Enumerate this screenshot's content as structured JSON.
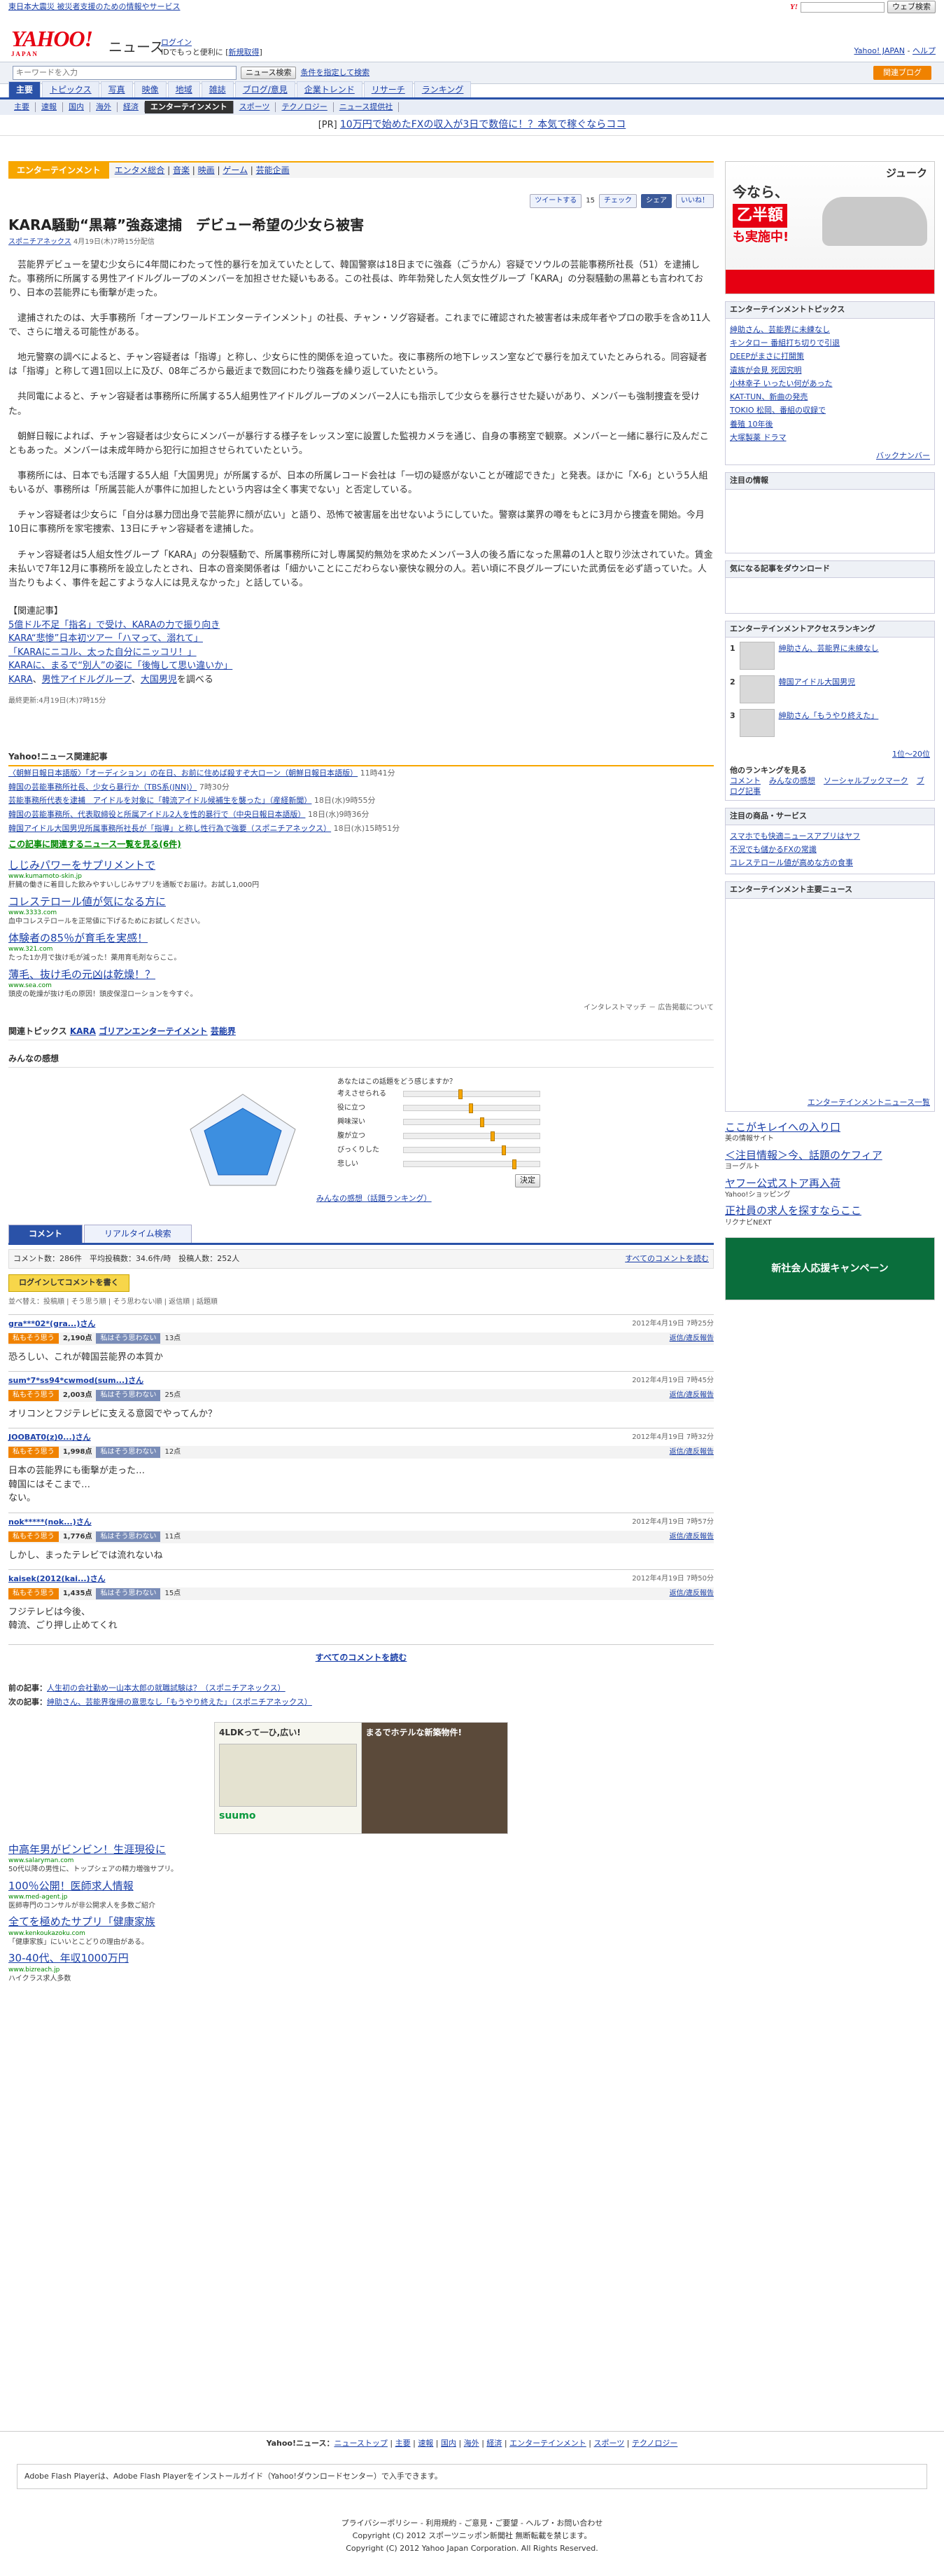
{
  "topbar": {
    "left_link": "東日本大震災 被災者支援のための情報やサービス",
    "search_btn": "ウェブ検索"
  },
  "header": {
    "logo": "YAHOO!",
    "logo_sub": "JAPAN",
    "section": "ニュース",
    "login": "ログイン",
    "login_note": "IDでもっと便利に",
    "signup": "新規取得",
    "right": "Yahoo! JAPAN",
    "help": "ヘルプ"
  },
  "search": {
    "placeholder": "キーワードを入力",
    "button": "ニュース検索",
    "advanced": "条件を指定して検索",
    "blog": "関連ブログ"
  },
  "nav": {
    "tabs": [
      "主要",
      "トピックス",
      "写真",
      "映像",
      "地域",
      "雑誌",
      "ブログ/意見",
      "企業トレンド",
      "リサーチ",
      "ランキング"
    ],
    "subs": [
      "主要",
      "速報",
      "国内",
      "海外",
      "経済",
      "エンターテインメント",
      "スポーツ",
      "テクノロジー",
      "ニュース提供社"
    ]
  },
  "pr": {
    "label": "[PR]",
    "text": "10万円で始めたFXの収入が3日で数倍に！？本気で稼ぐならココ"
  },
  "category": {
    "label": "エンターテインメント",
    "links": [
      "エンタメ総合",
      "音楽",
      "映画",
      "ゲーム",
      "芸能企画"
    ]
  },
  "share": {
    "tweet": "ツイートする",
    "count": "15",
    "check": "チェック",
    "share": "シェア",
    "like": "いいね！"
  },
  "article": {
    "title": "KARA騒動“黒幕”強姦逮捕　デビュー希望の少女ら被害",
    "source": "スポニチアネックス",
    "date": "4月19日(木)7時15分配信",
    "paragraphs": [
      "芸能界デビューを望む少女らに4年間にわたって性的暴行を加えていたとして、韓国警察は18日までに強姦（ごうかん）容疑でソウルの芸能事務所社長（51）を逮捕した。事務所に所属する男性アイドルグループのメンバーを加担させた疑いもある。この社長は、昨年勃発した人気女性グループ「KARA」の分裂騒動の黒幕とも言われており、日本の芸能界にも衝撃が走った。",
      "逮捕されたのは、大手事務所「オープンワールドエンターテインメント」の社長、チャン・ソグ容疑者。これまでに確認された被害者は未成年者やプロの歌手を含め11人で、さらに増える可能性がある。",
      "地元警察の調べによると、チャン容疑者は「指導」と称し、少女らに性的関係を迫っていた。夜に事務所の地下レッスン室などで暴行を加えていたとみられる。同容疑者は「指導」と称して週1回以上に及び、08年ごろから最近まで数回にわたり強姦を繰り返していたという。",
      "共同電によると、チャン容疑者は事務所に所属する5人組男性アイドルグループのメンバー2人にも指示して少女らを暴行させた疑いがあり、メンバーも強制捜査を受けた。",
      "朝鮮日報によれば、チャン容疑者は少女らにメンバーが暴行する様子をレッスン室に設置した監視カメラを通じ、自身の事務室で観察。メンバーと一緒に暴行に及んだこともあった。メンバーは未成年時から犯行に加担させられていたという。",
      "事務所には、日本でも活躍する5人組「大国男児」が所属するが、日本の所属レコード会社は「一切の疑惑がないことが確認できた」と発表。ほかに「X-6」という5人組もいるが、事務所は「所属芸能人が事件に加担したという内容は全く事実でない」と否定している。",
      "チャン容疑者は少女らに「自分は暴力団出身で芸能界に顔が広い」と語り、恐怖で被害届を出せないようにしていた。警察は業界の噂をもとに3月から捜査を開始。今月10日に事務所を家宅捜索、13日にチャン容疑者を逮捕した。",
      "チャン容疑者は5人組女性グループ「KARA」の分裂騒動で、所属事務所に対し専属契約無効を求めたメンバー3人の後ろ盾になった黒幕の1人と取り沙汰されていた。賃金未払いで7年12月に事務所を設立したとされ、日本の音楽関係者は「細かいことにこだわらない豪快な親分の人。若い頃に不良グループにいた武勇伝を必ず語っていた。人当たりもよく、事件を起こすような人には見えなかった」と話している。"
    ],
    "related_head": "【関連記事】",
    "related": [
      "5億ドル不足「指名」で受け、KARAの力で振り向き",
      "KARA“悲惨”日本初ツアー「ハマって、溺れて」",
      "「KARAにニコル、太った自分にニッコリ！」",
      "KARAに、まるで“別人”の姿に「後悔して思い違いか」"
    ],
    "related_tags": [
      "KARA",
      "男性アイドルグループ",
      "大国男児"
    ],
    "related_tail": "を調べる",
    "updated": "最終更新:4月19日(木)7時15分",
    "spon": "Sponichi Annex"
  },
  "yahoo_related": {
    "title": "Yahoo!ニュース関連記事",
    "items": [
      {
        "t": "〈朝鮮日報日本語版〉「オーディション」の在日、お前に住めば殺すぞ大ローン（朝鮮日報日本語版）",
        "d": "11時41分"
      },
      {
        "t": "韓国の芸能事務所社長、少女ら暴行か（TBS系(JNN)）",
        "d": "7時30分"
      },
      {
        "t": "芸能事務所代表を逮捕　アイドルを対象に「韓流アイドル候補生を襲った」（産経新聞）",
        "d": "18日(水)9時55分"
      },
      {
        "t": "韓国の芸能事務所、代表取締役と所属アイドル2人を性的暴行で（中央日報日本語版）",
        "d": "18日(水)9時36分"
      },
      {
        "t": "韓国アイドル大国男児所属事務所社長が「指導」と称し性行為で強要（スポニチアネックス）",
        "d": "18日(水)15時51分"
      }
    ],
    "more": "この記事に関連するニュース一覧を見る(6件)"
  },
  "ads": [
    {
      "t": "しじみパワーをサプリメントで",
      "u": "www.kumamoto-skin.jp",
      "d": "肝臓の働きに着目した飲みやすいしじみサプリを通販でお届け。お試し1,000円"
    },
    {
      "t": "コレステロール値が気になる方に",
      "u": "www.3333.com",
      "d": "血中コレステロールを正常値に下げるためにお試しください。"
    },
    {
      "t": "体験者の85％が育毛を実感！",
      "u": "www.321.com",
      "d": "たった1か月で抜け毛が減った！薬用育毛剤ならここ。"
    },
    {
      "t": "薄毛、抜け毛の元凶は乾燥！？",
      "u": "www.sea.com",
      "d": "頭皮の乾燥が抜け毛の原因！頭皮保湿ローションを今すぐ。"
    }
  ],
  "ads_note": "インタレストマッチ － 広告掲載について",
  "topics": {
    "label": "関連トピックス",
    "links": [
      "KARA",
      "ゴリアンエンターテイメント",
      "芸能界"
    ]
  },
  "feel": {
    "title": "みんなの感想",
    "q": "あなたはこの話題をどう感じますか？",
    "labels": [
      "考えさせられる",
      "役に立つ",
      "興味深い",
      "腹が立つ",
      "びっくりした",
      "悲しい"
    ],
    "submit": "決定",
    "rank_link": "みんなの感想（話題ランキング）"
  },
  "comments": {
    "tabs": [
      "コメント",
      "リアルタイム検索"
    ],
    "stats": "コメント数：286件　平均投稿数：34.6件/時　投稿人数：252人",
    "show_all": "すべてのコメントを読む",
    "post": "ログインしてコメントを書く",
    "sort": "並べ替え：投稿順 | そう思う順 | そう思わない順 | 返信順 | 話題順",
    "items": [
      {
        "user": "gra***02*(gra...)さん",
        "date": "2012年4月19日 7時25分",
        "agree": "2,190点",
        "disagree": "13点",
        "text": "恐ろしい、これが韓国芸能界の本質か"
      },
      {
        "user": "sum*7*ss94*cwmod(sum...)さん",
        "date": "2012年4月19日 7時45分",
        "agree": "2,003点",
        "disagree": "25点",
        "text": "オリコンとフジテレビに支える意図でやってんか？"
      },
      {
        "user": "JOOBAT0(z)0...)さん",
        "date": "2012年4月19日 7時32分",
        "agree": "1,998点",
        "disagree": "12点",
        "text": "日本の芸能界にも衝撃が走った…\n韓国にはそこまで…\nない。"
      },
      {
        "user": "nok*****(nok...)さん",
        "date": "2012年4月19日 7時57分",
        "agree": "1,776点",
        "disagree": "11点",
        "text": "しかし、まったテレビでは流れないね"
      },
      {
        "user": "kaisek(2012(kai...)さん",
        "date": "2012年4月19日 7時50分",
        "agree": "1,435点",
        "disagree": "15点",
        "text": "フジテレビは今後、\n韓流、ごり押し止めてくれ"
      }
    ],
    "agree_lbl": "私もそう思う",
    "disagree_lbl": "私はそう思わない",
    "reply": "返信/違反報告",
    "all": "すべてのコメントを読む"
  },
  "prevnext": {
    "prev_lbl": "前の記事：",
    "prev": "人生初の会社勤め一山本太郎の就職試験は？（スポニチアネックス）",
    "next_lbl": "次の記事：",
    "next": "紳助さん、芸能界復帰の意思なし「もうやり終えた」（スポニチアネックス）"
  },
  "bottom_ads": [
    {
      "t": "中高年男がビンビン！生涯現役に",
      "u": "www.salaryman.com",
      "d": "50代以降の男性に、トップシェアの精力増強サプリ。"
    },
    {
      "t": "100％公開！医師求人情報",
      "u": "www.med-agent.jp",
      "d": "医師専門のコンサルが非公開求人を多数ご紹介"
    },
    {
      "t": "全てを極めたサプリ「健康家族",
      "u": "www.kenkoukazoku.com",
      "d": "「健康家族」にいいとこどりの理由がある。"
    },
    {
      "t": "30-40代、年収1000万円",
      "u": "www.bizreach.jp",
      "d": "ハイクラス求人多数"
    }
  ],
  "suumo": {
    "a": "4LDKって一ひ,広い!",
    "b": "まるでホテルな新築物件!",
    "logo": "suumo"
  },
  "sidebar": {
    "ad_title": "ジューク",
    "ad_sub": "今なら、",
    "ad_lbl": "も実施中!",
    "topics_title": "エンターテインメントトピックス",
    "topics": [
      "紳助さん、芸能界に未練なし",
      "キンタロー 番組打ち切りで引退",
      "DEEPがまさに打開策",
      "遺族が会見 死因究明",
      "小林幸子 いったい何があった",
      "KAT-TUN、新曲の発売",
      "TOKIO 松岡、番組の収録で",
      "養殖 10年後",
      "大塚製薬 ドラマ"
    ],
    "backnumber": "バックナンバー",
    "attn_title": "注目の情報",
    "biz_title": "気になる記事をダウンロード",
    "rank_title": "エンターテインメントアクセスランキング",
    "rank": [
      {
        "t": "紳助さん、芸能界に未練なし"
      },
      {
        "t": "韓国アイドル大国男児"
      },
      {
        "t": "紳助さん「もうやり終えた」"
      }
    ],
    "rank_more": "1位〜20位",
    "other_rank": "他のランキングを見る",
    "other_links": [
      "コメント",
      "みんなの感想",
      "ソーシャルブックマーク",
      "ブログ記事"
    ],
    "pick_title": "注目の商品・サービス",
    "pick": [
      "スマホでも快適ニュースアプリはヤフ",
      "不況でも儲かるFXの常識",
      "コレステロール値が高めな方の食事"
    ],
    "main_title": "エンターテインメント主要ニュース",
    "main_more": "エンターテインメントニュース一覧",
    "side_ads": [
      {
        "t": "ここがキレイへの入り口",
        "d": "美の情報サイト"
      },
      {
        "t": "＜注目情報＞今、話題のケフィア",
        "d": "ヨーグルト"
      },
      {
        "t": "ヤフー公式ストア再入荷",
        "d": "Yahoo!ショッピング"
      },
      {
        "t": "正社員の求人を探すならここ",
        "d": "リクナビNEXT"
      }
    ],
    "pr2_title": "新社会人応援キャンペーン"
  },
  "footer": {
    "crumbs": [
      "ニューストップ",
      "主要",
      "速報",
      "国内",
      "海外",
      "経済",
      "エンターテインメント",
      "スポーツ",
      "テクノロジー"
    ],
    "flash": "Adobe Flash Playerは、Adobe Flash Playerをインストールガイド（Yahoo!ダウンロードセンター）で入手できます。",
    "links": "プライバシーポリシー - 利用規約 - ご意見・ご要望 - ヘルプ・お問い合わせ",
    "copy1": "Copyright (C) 2012 スポーツニッポン新聞社 無断転載を禁じます。",
    "copy2": "Copyright (C) 2012 Yahoo Japan Corporation. All Rights Reserved."
  }
}
